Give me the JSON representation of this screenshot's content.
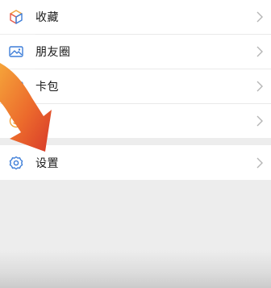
{
  "menu": {
    "items": [
      {
        "label": "收藏",
        "icon": "favorites-cube-icon"
      },
      {
        "label": "朋友圈",
        "icon": "moments-picture-icon"
      },
      {
        "label": "卡包",
        "icon": "card-pack-icon"
      },
      {
        "label": "",
        "icon": "emoji-icon"
      },
      {
        "label": "设置",
        "icon": "settings-gear-icon"
      }
    ]
  },
  "colors": {
    "accent_blue": "#3d7dd8",
    "arrow_orange": "#f08a2a",
    "arrow_red": "#d9432a",
    "row_background": "#ffffff",
    "page_background": "#ededed"
  }
}
